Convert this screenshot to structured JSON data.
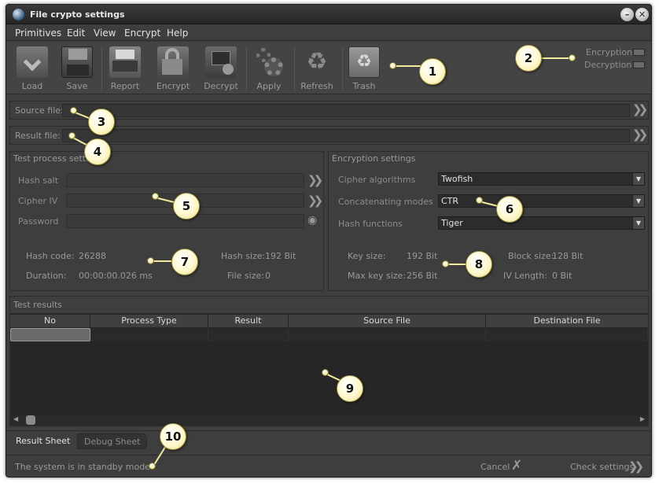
{
  "window": {
    "title": "File crypto settings"
  },
  "menu": [
    "Primitives",
    "Edit",
    "View",
    "Encrypt",
    "Help"
  ],
  "toolbar": {
    "buttons": [
      "Load",
      "Save",
      "Report",
      "Encrypt",
      "Decrypt",
      "Apply",
      "Refresh",
      "Trash"
    ]
  },
  "indicators": {
    "encryption": "Encryption",
    "decryption": "Decryption"
  },
  "source_file": {
    "label": "Source file:",
    "value": ""
  },
  "result_file": {
    "label": "Result file:",
    "value": ""
  },
  "test_process": {
    "title": "Test process settings",
    "hash_salt": "Hash salt",
    "cipher_iv": "Cipher IV",
    "password": "Password",
    "hash_code_label": "Hash code:",
    "hash_code": "26288",
    "duration_label": "Duration:",
    "duration": "00:00:00.026 ms",
    "hash_size_label": "Hash size:",
    "hash_size": "192 Bit",
    "file_size_label": "File size:",
    "file_size": "0"
  },
  "encryption_settings": {
    "title": "Encryption settings",
    "cipher_algorithms_label": "Cipher algorithms",
    "cipher_algorithm": "Twofish",
    "concatenating_modes_label": "Concatenating modes",
    "concatenating_mode": "CTR",
    "hash_functions_label": "Hash functions",
    "hash_function": "Tiger",
    "key_size_label": "Key size:",
    "key_size": "192 Bit",
    "max_key_size_label": "Max key size:",
    "max_key_size": "256 Bit",
    "block_size_label": "Block size:",
    "block_size": "128 Bit",
    "iv_length_label": "IV Length:",
    "iv_length": "0 Bit"
  },
  "results": {
    "title": "Test results",
    "columns": [
      "No",
      "Process Type",
      "Result",
      "Source File",
      "Destination File"
    ]
  },
  "tabs": [
    "Result Sheet",
    "Debug Sheet"
  ],
  "status": {
    "message": "The system is in standby mode.",
    "cancel": "Cancel",
    "check": "Check settings"
  },
  "callouts": [
    "1",
    "2",
    "3",
    "4",
    "5",
    "6",
    "7",
    "8",
    "9",
    "10"
  ]
}
